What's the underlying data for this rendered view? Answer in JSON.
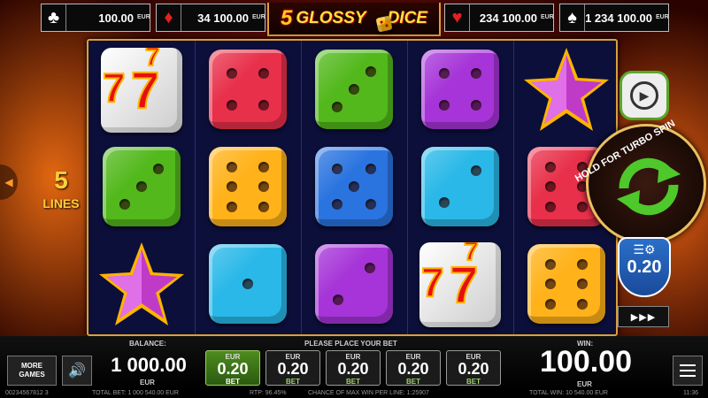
{
  "title": "5 GLOSSY DICE",
  "jackpots": [
    {
      "suit": "♣",
      "value": "100.00",
      "currency": "EUR",
      "color": "#ffffff"
    },
    {
      "suit": "♦",
      "value": "34 100.00",
      "currency": "EUR",
      "color": "#e52020"
    },
    {
      "suit": "♥",
      "value": "234 100.00",
      "currency": "EUR",
      "color": "#e52020"
    },
    {
      "suit": "♠",
      "value": "1 234 100.00",
      "currency": "EUR",
      "color": "#ffffff"
    }
  ],
  "logo": {
    "number": "5",
    "word1": "GLOSSY",
    "word2": "DICE"
  },
  "reels": [
    [
      "seven",
      {
        "die": "red",
        "pips": 4
      },
      {
        "die": "green",
        "pips": 3
      },
      {
        "die": "purple",
        "pips": 4
      },
      "star"
    ],
    [
      {
        "die": "green",
        "pips": 3
      },
      {
        "die": "yellow",
        "pips": 6
      },
      {
        "die": "blue",
        "pips": 5
      },
      {
        "die": "cyan",
        "pips": 2
      },
      {
        "die": "red",
        "pips": 6
      }
    ],
    [
      "star",
      {
        "die": "cyan",
        "pips": 1
      },
      {
        "die": "purple",
        "pips": 2
      },
      "seven",
      {
        "die": "yellow",
        "pips": 6
      }
    ]
  ],
  "die_colors": {
    "red": "#e8304a",
    "green": "#52b81c",
    "purple": "#a634d8",
    "yellow": "#ffb21a",
    "blue": "#2a74e0",
    "cyan": "#29b8e8"
  },
  "lines": {
    "count": "5",
    "label": "LINES"
  },
  "spin": {
    "label": "HOLD FOR TURBO SPIN"
  },
  "bet_setting": {
    "value": "0.20"
  },
  "balance": {
    "label": "BALANCE:",
    "value": "1 000.00",
    "currency": "EUR"
  },
  "bet_prompt": "PLEASE PLACE YOUR BET",
  "bets": [
    {
      "currency": "EUR",
      "value": "0.20",
      "label": "BET",
      "selected": true
    },
    {
      "currency": "EUR",
      "value": "0.20",
      "label": "BET",
      "selected": false
    },
    {
      "currency": "EUR",
      "value": "0.20",
      "label": "BET",
      "selected": false
    },
    {
      "currency": "EUR",
      "value": "0.20",
      "label": "BET",
      "selected": false
    },
    {
      "currency": "EUR",
      "value": "0.20",
      "label": "BET",
      "selected": false
    }
  ],
  "win": {
    "label": "WIN:",
    "value": "100.00",
    "currency": "EUR"
  },
  "more_games": "MORE GAMES",
  "status": {
    "id": "00234567812 3",
    "total_bet": "TOTAL BET: 1 000 540.00 EUR",
    "rtp": "RTP: 96.45%",
    "chance": "CHANCE OF MAX WIN PER LINE: 1:25907",
    "total_win": "TOTAL WIN: 10 540.00 EUR",
    "time": "11:36"
  },
  "icons": [
    "prev-icon",
    "autoplay-icon",
    "spin-arrows-icon",
    "bet-settings-icon",
    "sound-icon",
    "menu-icon",
    "fast-forward-icon"
  ]
}
